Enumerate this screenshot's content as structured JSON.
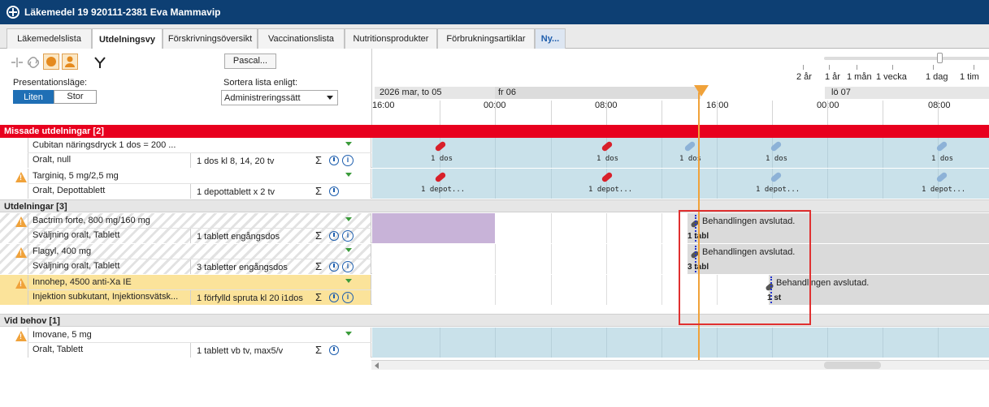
{
  "window": {
    "title": "Läkemedel 19 920111-2381 Eva Mammavip"
  },
  "tabs": [
    "Läkemedelslista",
    "Utdelningsvy",
    "Förskrivningsöversikt",
    "Vaccinationslista",
    "Nutritionsprodukter",
    "Förbrukningsartiklar",
    "Ny..."
  ],
  "toolbar": {
    "pascal_button": "Pascal...",
    "presentation_label": "Presentationsläge:",
    "size_small": "Liten",
    "size_large": "Stor",
    "sort_label": "Sortera lista enligt:",
    "sort_value": "Administreringssätt"
  },
  "scale": [
    "2 år",
    "1 år",
    "1 mån",
    "1 vecka",
    "1 dag",
    "1 tim"
  ],
  "time_header": {
    "day1": "2026 mar, to 05",
    "day2": "fr 06",
    "day3": "lö 07",
    "hours": [
      "16:00",
      "00:00",
      "08:00",
      "16:00",
      "00:00",
      "08:00"
    ]
  },
  "sections": {
    "missed": "Missade utdelningar [2]",
    "dispensings": "Utdelningar [3]",
    "as_needed": "Vid behov [1]"
  },
  "rows": [
    {
      "name": "Cubitan näringsdryck 1 dos = 200 ...",
      "route": "Oralt, null",
      "dose": "1 dos kl 8, 14, 20 tv",
      "tl_label": "1 dos"
    },
    {
      "name": "Targiniq, 5 mg/2,5 mg",
      "route": "Oralt, Depottablett",
      "dose": "1 depottablett x 2 tv",
      "tl_label": "1 depot..."
    },
    {
      "name": "Bactrim forte, 800 mg/160 mg",
      "route": "Sväljning oralt, Tablett",
      "dose": "1 tablett engångsdos",
      "tl_label": "1 tabl"
    },
    {
      "name": "Flagyl, 400 mg",
      "route": "Sväljning oralt, Tablett",
      "dose": "3 tabletter engångsdos",
      "tl_label": "3 tabl"
    },
    {
      "name": "Innohep, 4500 anti-Xa IE",
      "route": "Injektion subkutant, Injektionsvätsk...",
      "dose": "1 förfylld spruta kl 20 i1dos",
      "tl_label": "1 st"
    },
    {
      "name": "Imovane, 5 mg",
      "route": "Oralt, Tablett",
      "dose": "1 tablett vb tv, max5/v"
    }
  ],
  "treatment_ended": "Behandlingen avslutad.",
  "symbols": {
    "sigma": "Σ",
    "info": "i"
  },
  "colors": {
    "title": "#0d3f73",
    "missed": "#e8001e",
    "timeline": "#c9e1ea",
    "warning": "#f0a23a",
    "now": "#f0a23a"
  }
}
